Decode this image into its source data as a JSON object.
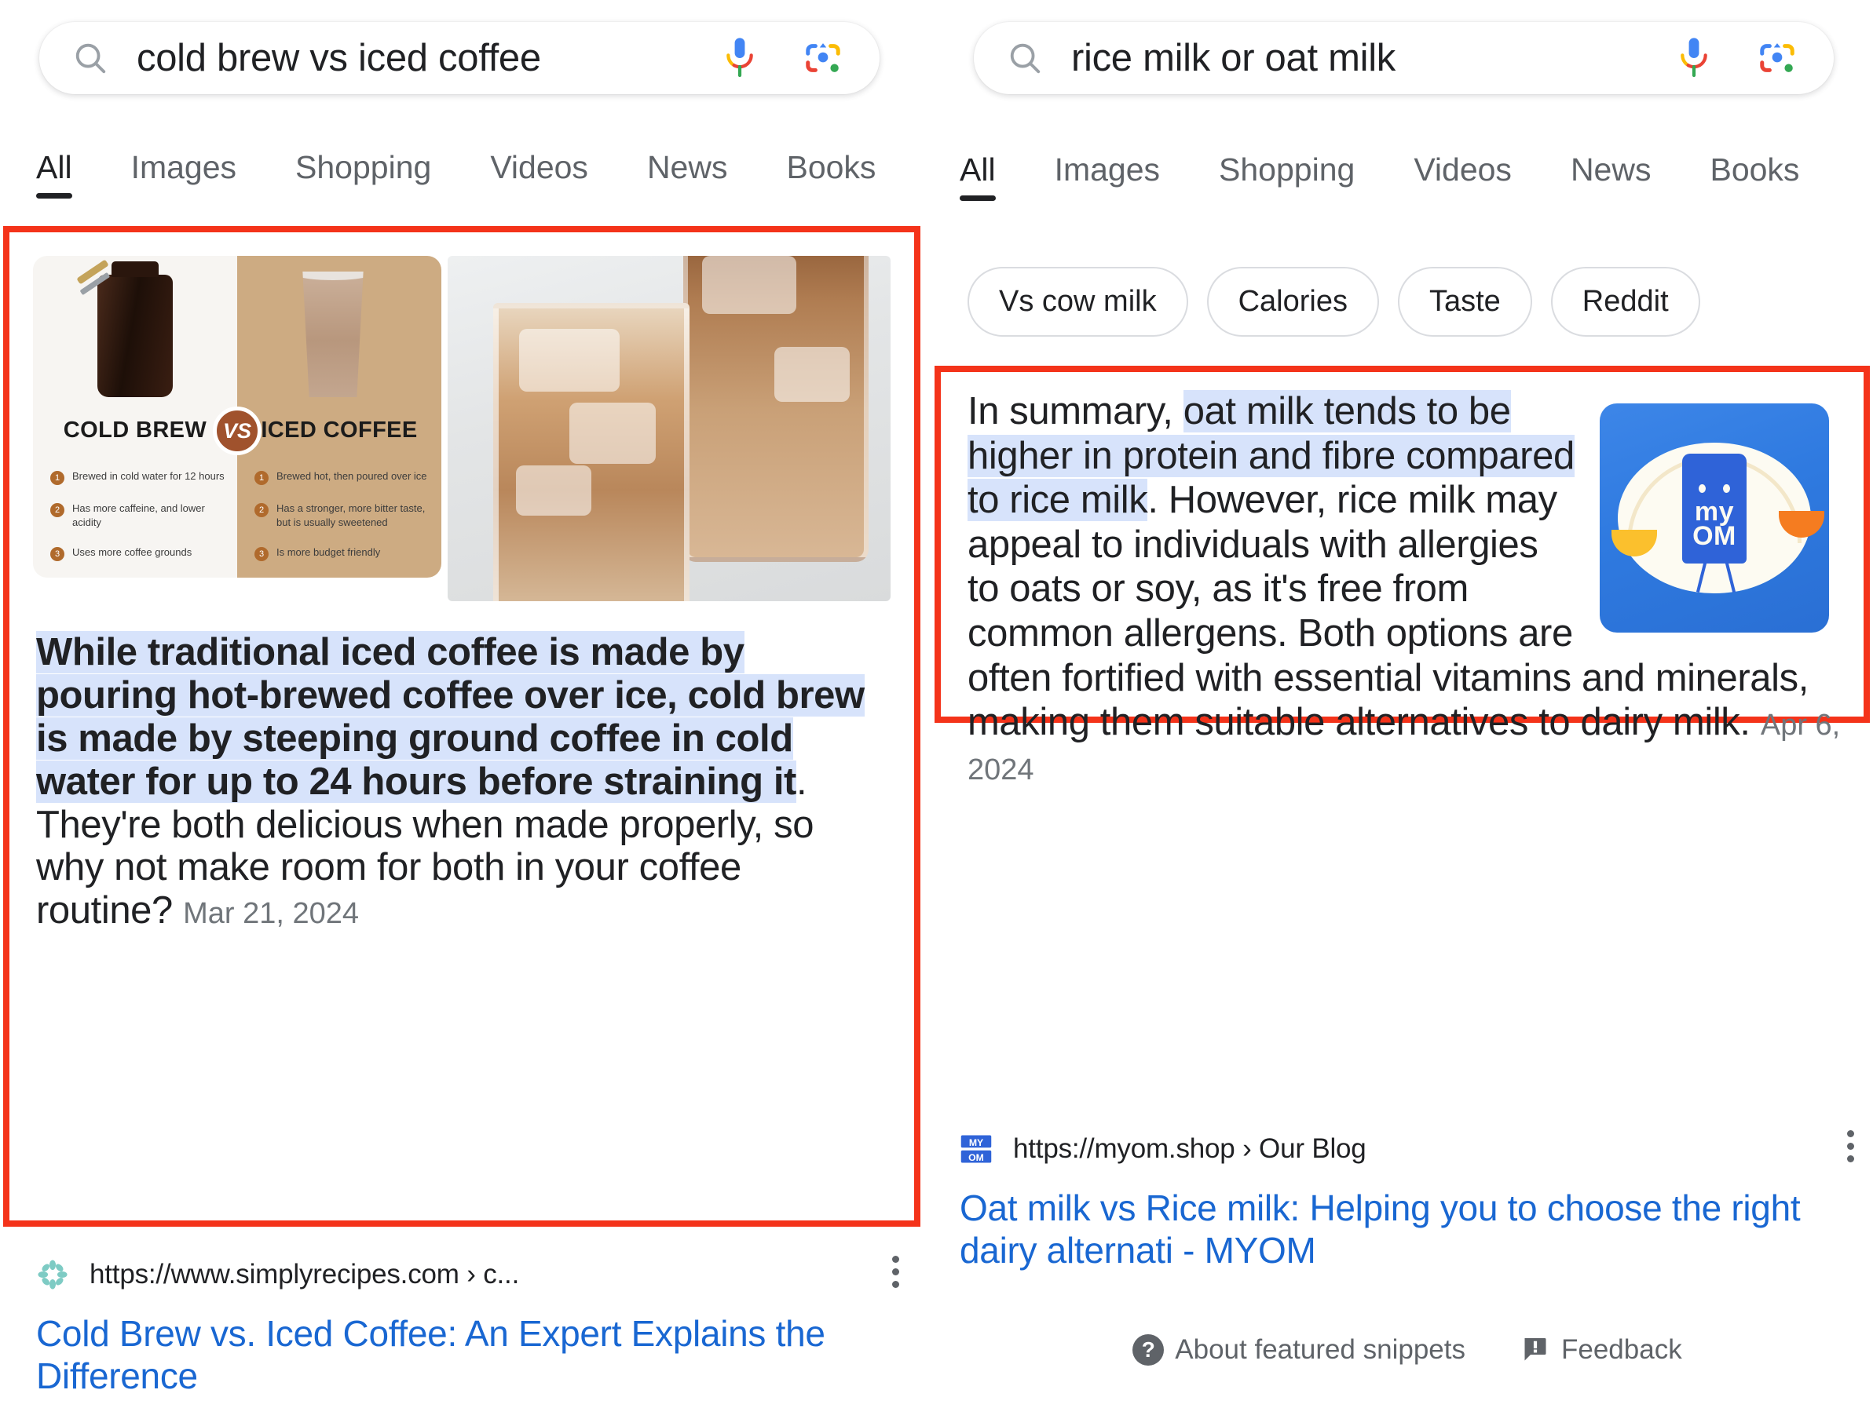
{
  "left_panel": {
    "search": {
      "query": "cold brew vs iced coffee",
      "placeholder": "Search",
      "mic_icon": "microphone-icon",
      "lens_icon": "google-lens-icon",
      "search_icon": "search-icon"
    },
    "tabs": [
      {
        "label": "All",
        "active": true
      },
      {
        "label": "Images",
        "active": false
      },
      {
        "label": "Shopping",
        "active": false
      },
      {
        "label": "Videos",
        "active": false
      },
      {
        "label": "News",
        "active": false
      },
      {
        "label": "Books",
        "active": false
      }
    ],
    "featured_snippet": {
      "infographic": {
        "left_title": "COLD BREW",
        "vs_badge": "VS",
        "right_title": "ICED COFFEE",
        "left_bullets": [
          "Brewed in cold water for 12 hours",
          "Has more caffeine, and lower acidity",
          "Uses more coffee grounds"
        ],
        "right_bullets": [
          "Brewed hot, then poured over ice",
          "Has a stronger, more bitter taste, but is usually sweetened",
          "Is more budget friendly"
        ]
      },
      "highlighted_text": "While traditional iced coffee is made by pouring hot-brewed coffee over ice, cold brew is made by steeping ground coffee in cold water for up to 24 hours before straining it",
      "rest_text": ". They're both delicious when made properly, so why not make room for both in your coffee routine?",
      "date": "Mar 21, 2024"
    },
    "result": {
      "url": "https://www.simplyrecipes.com › c...",
      "favicon": "simplyrecipes-flower-icon",
      "title": "Cold Brew vs. Iced Coffee: An Expert Explains the Difference",
      "kebab": "more-options-icon"
    }
  },
  "right_panel": {
    "search": {
      "query": "rice milk or oat milk",
      "placeholder": "Search",
      "mic_icon": "microphone-icon",
      "lens_icon": "google-lens-icon",
      "search_icon": "search-icon"
    },
    "tabs": [
      {
        "label": "All",
        "active": true
      },
      {
        "label": "Images",
        "active": false
      },
      {
        "label": "Shopping",
        "active": false
      },
      {
        "label": "Videos",
        "active": false
      },
      {
        "label": "News",
        "active": false
      },
      {
        "label": "Books",
        "active": false
      }
    ],
    "chips": [
      "Vs cow milk",
      "Calories",
      "Taste",
      "Reddit"
    ],
    "featured_snippet": {
      "lead_text": "In summary, ",
      "highlighted_text": "oat milk tends to be higher in protein and fibre compared to rice milk",
      "rest_text": ". However, rice milk may appeal to individuals with allergies to oats or soy, as it's free from common allergens. Both options are often fortified with essential vitamins and minerals, making them suitable alternatives to dairy milk.",
      "date": "Apr 6, 2024",
      "thumbnail": {
        "alt": "myom-logo-thumbnail",
        "brand_line_1": "my",
        "brand_line_2": "OM"
      }
    },
    "result": {
      "url": "https://myom.shop › Our Blog",
      "favicon": "myom-favicon",
      "title": "Oat milk vs Rice milk: Helping you to choose the right dairy alternati - MYOM",
      "kebab": "more-options-icon"
    },
    "footer": {
      "about_label": "About featured snippets",
      "about_icon": "question-mark-icon",
      "feedback_label": "Feedback",
      "feedback_icon": "feedback-flag-icon"
    }
  },
  "annotation": {
    "box_color": "#f4331a"
  }
}
